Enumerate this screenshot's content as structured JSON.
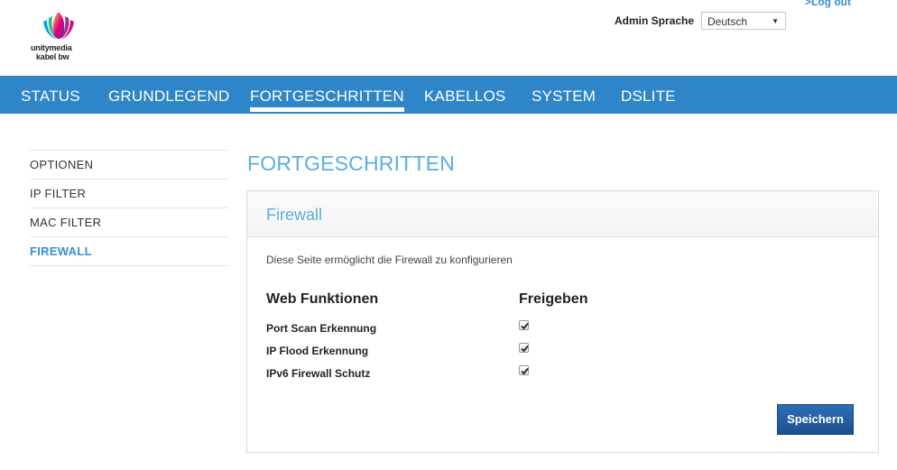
{
  "brand": {
    "line1": "unitymedia",
    "line2": "kabel bw"
  },
  "header": {
    "logout": ">Log out",
    "lang_label": "Admin Sprache",
    "lang_value": "Deutsch"
  },
  "nav": [
    "STATUS",
    "GRUNDLEGEND",
    "FORTGESCHRITTEN",
    "KABELLOS",
    "SYSTEM",
    "DSLITE"
  ],
  "nav_active": "FORTGESCHRITTEN",
  "sidebar": [
    "OPTIONEN",
    "IP FILTER",
    "MAC FILTER",
    "FIREWALL"
  ],
  "sidebar_active": "FIREWALL",
  "main": {
    "title": "FORTGESCHRITTEN",
    "panel_title": "Firewall",
    "description": "Diese Seite ermöglicht die Firewall zu konfigurieren",
    "col_functions": "Web Funktionen",
    "col_enable": "Freigeben",
    "rows": [
      {
        "label": "Port Scan Erkennung",
        "checked": true
      },
      {
        "label": "IP Flood Erkennung",
        "checked": true
      },
      {
        "label": "IPv6 Firewall Schutz",
        "checked": true
      }
    ],
    "save": "Speichern"
  },
  "colors": {
    "nav_bg": "#2e86c8",
    "accent": "#5aaee0",
    "button": "#1f5496"
  }
}
